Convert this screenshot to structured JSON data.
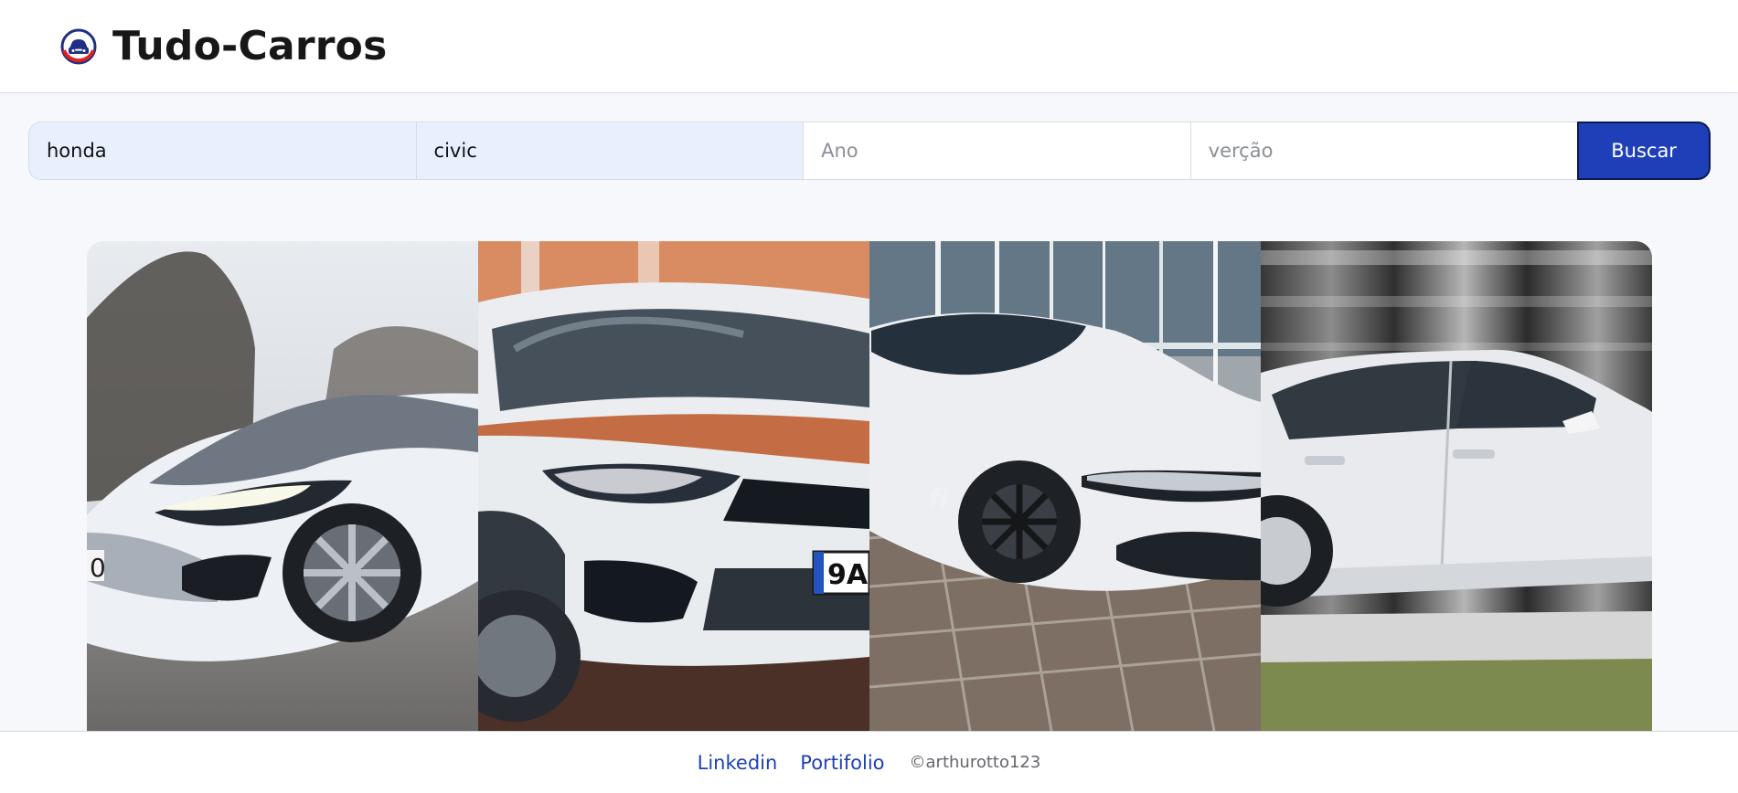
{
  "header": {
    "brand_logo_icon": "car-logo-icon",
    "title": "Tudo-Carros"
  },
  "search": {
    "fields": [
      {
        "value": "honda",
        "placeholder": ""
      },
      {
        "value": "civic",
        "placeholder": ""
      },
      {
        "value": "",
        "placeholder": "Ano"
      },
      {
        "value": "",
        "placeholder": "verção"
      }
    ],
    "button_label": "Buscar"
  },
  "gallery": {
    "photos": [
      "white-sedan-front-left-photo",
      "white-sedan-front-closeup-photo",
      "white-sedan-front-right-photo",
      "white-sedan-side-photo"
    ]
  },
  "footer": {
    "links": [
      "Linkedin",
      "Portifolio"
    ],
    "copyright": "©arthurotto123"
  },
  "colors": {
    "brand": "#1f3fb8",
    "logo_red": "#d82323",
    "field_filled": "#e8f0fe",
    "background": "#f6f8fb"
  }
}
